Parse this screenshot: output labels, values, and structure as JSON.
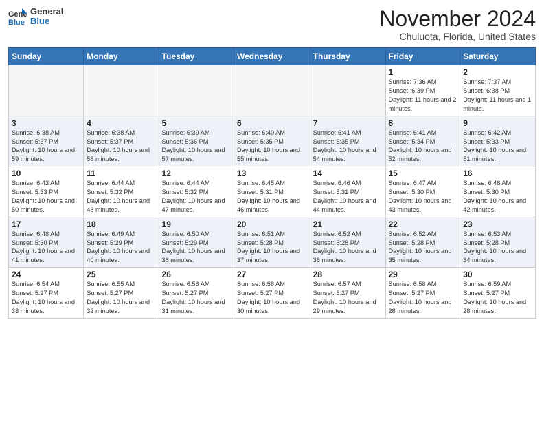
{
  "header": {
    "logo_general": "General",
    "logo_blue": "Blue",
    "month_title": "November 2024",
    "location": "Chuluota, Florida, United States"
  },
  "weekdays": [
    "Sunday",
    "Monday",
    "Tuesday",
    "Wednesday",
    "Thursday",
    "Friday",
    "Saturday"
  ],
  "weeks": [
    [
      {
        "day": "",
        "empty": true
      },
      {
        "day": "",
        "empty": true
      },
      {
        "day": "",
        "empty": true
      },
      {
        "day": "",
        "empty": true
      },
      {
        "day": "",
        "empty": true
      },
      {
        "day": "1",
        "sunrise": "Sunrise: 7:36 AM",
        "sunset": "Sunset: 6:39 PM",
        "daylight": "Daylight: 11 hours and 2 minutes."
      },
      {
        "day": "2",
        "sunrise": "Sunrise: 7:37 AM",
        "sunset": "Sunset: 6:38 PM",
        "daylight": "Daylight: 11 hours and 1 minute."
      }
    ],
    [
      {
        "day": "3",
        "sunrise": "Sunrise: 6:38 AM",
        "sunset": "Sunset: 5:37 PM",
        "daylight": "Daylight: 10 hours and 59 minutes."
      },
      {
        "day": "4",
        "sunrise": "Sunrise: 6:38 AM",
        "sunset": "Sunset: 5:37 PM",
        "daylight": "Daylight: 10 hours and 58 minutes."
      },
      {
        "day": "5",
        "sunrise": "Sunrise: 6:39 AM",
        "sunset": "Sunset: 5:36 PM",
        "daylight": "Daylight: 10 hours and 57 minutes."
      },
      {
        "day": "6",
        "sunrise": "Sunrise: 6:40 AM",
        "sunset": "Sunset: 5:35 PM",
        "daylight": "Daylight: 10 hours and 55 minutes."
      },
      {
        "day": "7",
        "sunrise": "Sunrise: 6:41 AM",
        "sunset": "Sunset: 5:35 PM",
        "daylight": "Daylight: 10 hours and 54 minutes."
      },
      {
        "day": "8",
        "sunrise": "Sunrise: 6:41 AM",
        "sunset": "Sunset: 5:34 PM",
        "daylight": "Daylight: 10 hours and 52 minutes."
      },
      {
        "day": "9",
        "sunrise": "Sunrise: 6:42 AM",
        "sunset": "Sunset: 5:33 PM",
        "daylight": "Daylight: 10 hours and 51 minutes."
      }
    ],
    [
      {
        "day": "10",
        "sunrise": "Sunrise: 6:43 AM",
        "sunset": "Sunset: 5:33 PM",
        "daylight": "Daylight: 10 hours and 50 minutes."
      },
      {
        "day": "11",
        "sunrise": "Sunrise: 6:44 AM",
        "sunset": "Sunset: 5:32 PM",
        "daylight": "Daylight: 10 hours and 48 minutes."
      },
      {
        "day": "12",
        "sunrise": "Sunrise: 6:44 AM",
        "sunset": "Sunset: 5:32 PM",
        "daylight": "Daylight: 10 hours and 47 minutes."
      },
      {
        "day": "13",
        "sunrise": "Sunrise: 6:45 AM",
        "sunset": "Sunset: 5:31 PM",
        "daylight": "Daylight: 10 hours and 46 minutes."
      },
      {
        "day": "14",
        "sunrise": "Sunrise: 6:46 AM",
        "sunset": "Sunset: 5:31 PM",
        "daylight": "Daylight: 10 hours and 44 minutes."
      },
      {
        "day": "15",
        "sunrise": "Sunrise: 6:47 AM",
        "sunset": "Sunset: 5:30 PM",
        "daylight": "Daylight: 10 hours and 43 minutes."
      },
      {
        "day": "16",
        "sunrise": "Sunrise: 6:48 AM",
        "sunset": "Sunset: 5:30 PM",
        "daylight": "Daylight: 10 hours and 42 minutes."
      }
    ],
    [
      {
        "day": "17",
        "sunrise": "Sunrise: 6:48 AM",
        "sunset": "Sunset: 5:30 PM",
        "daylight": "Daylight: 10 hours and 41 minutes."
      },
      {
        "day": "18",
        "sunrise": "Sunrise: 6:49 AM",
        "sunset": "Sunset: 5:29 PM",
        "daylight": "Daylight: 10 hours and 40 minutes."
      },
      {
        "day": "19",
        "sunrise": "Sunrise: 6:50 AM",
        "sunset": "Sunset: 5:29 PM",
        "daylight": "Daylight: 10 hours and 38 minutes."
      },
      {
        "day": "20",
        "sunrise": "Sunrise: 6:51 AM",
        "sunset": "Sunset: 5:28 PM",
        "daylight": "Daylight: 10 hours and 37 minutes."
      },
      {
        "day": "21",
        "sunrise": "Sunrise: 6:52 AM",
        "sunset": "Sunset: 5:28 PM",
        "daylight": "Daylight: 10 hours and 36 minutes."
      },
      {
        "day": "22",
        "sunrise": "Sunrise: 6:52 AM",
        "sunset": "Sunset: 5:28 PM",
        "daylight": "Daylight: 10 hours and 35 minutes."
      },
      {
        "day": "23",
        "sunrise": "Sunrise: 6:53 AM",
        "sunset": "Sunset: 5:28 PM",
        "daylight": "Daylight: 10 hours and 34 minutes."
      }
    ],
    [
      {
        "day": "24",
        "sunrise": "Sunrise: 6:54 AM",
        "sunset": "Sunset: 5:27 PM",
        "daylight": "Daylight: 10 hours and 33 minutes."
      },
      {
        "day": "25",
        "sunrise": "Sunrise: 6:55 AM",
        "sunset": "Sunset: 5:27 PM",
        "daylight": "Daylight: 10 hours and 32 minutes."
      },
      {
        "day": "26",
        "sunrise": "Sunrise: 6:56 AM",
        "sunset": "Sunset: 5:27 PM",
        "daylight": "Daylight: 10 hours and 31 minutes."
      },
      {
        "day": "27",
        "sunrise": "Sunrise: 6:56 AM",
        "sunset": "Sunset: 5:27 PM",
        "daylight": "Daylight: 10 hours and 30 minutes."
      },
      {
        "day": "28",
        "sunrise": "Sunrise: 6:57 AM",
        "sunset": "Sunset: 5:27 PM",
        "daylight": "Daylight: 10 hours and 29 minutes."
      },
      {
        "day": "29",
        "sunrise": "Sunrise: 6:58 AM",
        "sunset": "Sunset: 5:27 PM",
        "daylight": "Daylight: 10 hours and 28 minutes."
      },
      {
        "day": "30",
        "sunrise": "Sunrise: 6:59 AM",
        "sunset": "Sunset: 5:27 PM",
        "daylight": "Daylight: 10 hours and 28 minutes."
      }
    ]
  ]
}
